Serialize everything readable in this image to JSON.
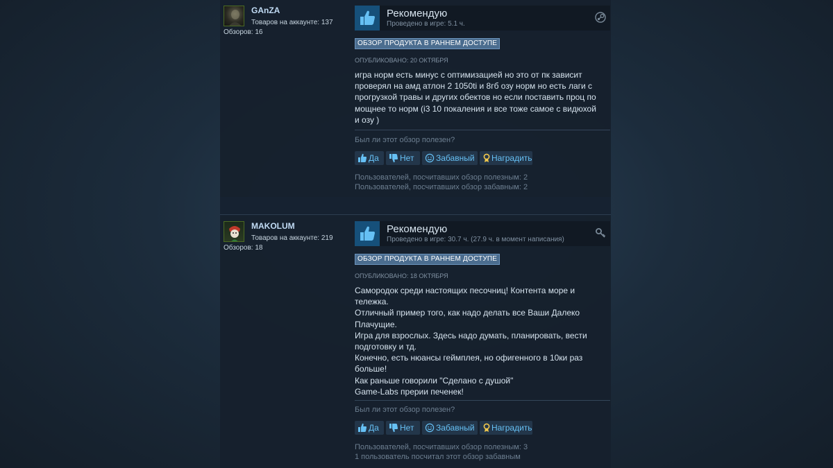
{
  "reviews": [
    {
      "author": "GAnZA",
      "owned": "Товаров на аккаунте: 137",
      "reviews_count": "Обзоров: 16",
      "verdict": "Рекомендую",
      "playtime": "Проведено в игре: 5.1 ч.",
      "early_access": "ОБЗОР ПРОДУКТА В РАННЕМ ДОСТУПЕ",
      "posted": "ОПУБЛИКОВАНО: 20 ОКТЯБРЯ",
      "body": [
        "игра норм есть минус с оптимизацией но это от пк зависит",
        "проверял на амд атлон 2 1050ti и 8гб озу норм но есть лаги с",
        "прогрузкой травы и других обектов но если поставить проц по",
        "мощнее то норм (i3 10 покаления и все тоже самое с видюхой",
        "и озу )"
      ],
      "helpful_question": "Был ли этот обзор полезен?",
      "buttons": {
        "yes": "Да",
        "no": "Нет",
        "funny": "Забавный",
        "award": "Наградить"
      },
      "stats": [
        "Пользователей, посчитавших обзор полезным: 2",
        "Пользователей, посчитавших обзор забавным: 2"
      ],
      "corner_icon": "steam-icon"
    },
    {
      "author": "MAKOLUM",
      "owned": "Товаров на аккаунте: 219",
      "reviews_count": "Обзоров: 18",
      "verdict": "Рекомендую",
      "playtime": "Проведено в игре: 30.7 ч. (27.9 ч. в момент написания)",
      "early_access": "ОБЗОР ПРОДУКТА В РАННЕМ ДОСТУПЕ",
      "posted": "ОПУБЛИКОВАНО: 18 ОКТЯБРЯ",
      "body": [
        "Самородок среди настоящих песочниц! Контента море и",
        "тележка.",
        "Отличный пример того, как надо делать все Ваши Далеко",
        "Плачущие.",
        "Игра для взрослых. Здесь надо думать, планировать, вести",
        "подготовку и тд.",
        "Конечно, есть нюансы геймплея, но офигенного в 10ки раз",
        "больше!",
        "Как раньше говорили \"Сделано с душой\"",
        "Game-Labs прерии печенек!"
      ],
      "helpful_question": "Был ли этот обзор полезен?",
      "buttons": {
        "yes": "Да",
        "no": "Нет",
        "funny": "Забавный",
        "award": "Наградить"
      },
      "stats": [
        "Пользователей, посчитавших обзор полезным: 3",
        "1 пользователь посчитал этот обзор забавным"
      ],
      "corner_icon": "key-icon"
    }
  ],
  "colors": {
    "accent_link": "#66c0f4",
    "author_name": "#c1dbf4",
    "thumb_box": "#16507a",
    "early_access_bg": "#4b6d8f"
  }
}
